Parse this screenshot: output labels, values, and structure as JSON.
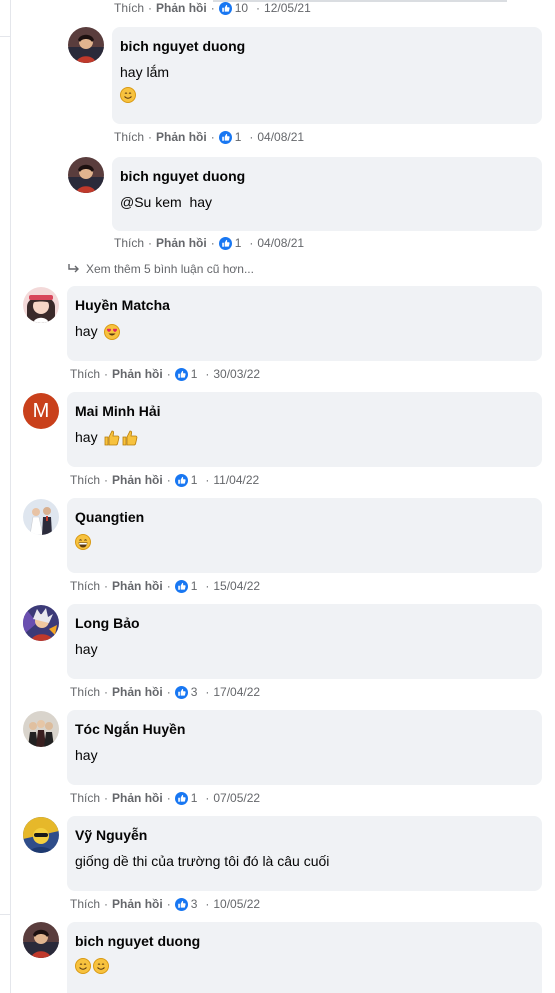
{
  "labels": {
    "like": "Thích",
    "reply": "Phản hồi",
    "dot": "·"
  },
  "top_meta": {
    "count": "10",
    "date": "12/05/21"
  },
  "replies": [
    {
      "author": "bich nguyet duong",
      "text": "hay lắm",
      "emoji": [
        "smile"
      ],
      "likes": "1",
      "date": "04/08/21"
    },
    {
      "author": "bich nguyet duong",
      "text": "@Su kem  hay",
      "emoji": [],
      "likes": "1",
      "date": "04/08/21"
    }
  ],
  "see_more": {
    "label": "Xem thêm 5 bình luận cũ hơn..."
  },
  "comments": [
    {
      "author": "Huyền Matcha",
      "text": "hay",
      "emoji": [
        "heart-eyes"
      ],
      "likes": "1",
      "date": "30/03/22",
      "avatar": "photo-girl"
    },
    {
      "author": "Mai Minh Hải",
      "text": "hay",
      "emoji": [
        "thumbs-up",
        "thumbs-up"
      ],
      "likes": "1",
      "date": "11/04/22",
      "avatar": "letter",
      "avatar_letter": "M",
      "avatar_color": "#c9401b"
    },
    {
      "author": "Quangtien",
      "text": "",
      "emoji": [
        "grin"
      ],
      "likes": "1",
      "date": "15/04/22",
      "avatar": "photo-couple"
    },
    {
      "author": "Long Bảo",
      "text": "hay",
      "emoji": [],
      "likes": "3",
      "date": "17/04/22",
      "avatar": "photo-anime"
    },
    {
      "author": "Tóc Ngắn Huyền",
      "text": "hay",
      "emoji": [],
      "likes": "1",
      "date": "07/05/22",
      "avatar": "photo-group"
    },
    {
      "author": "Vỹ Nguyễn",
      "text": "giống dề thi của trường tôi đó là câu cuối",
      "emoji": [],
      "likes": "3",
      "date": "10/05/22",
      "avatar": "photo-yellow"
    },
    {
      "author": "bich nguyet duong",
      "text": "",
      "emoji": [
        "smile",
        "smile"
      ],
      "likes": "",
      "date": "",
      "avatar": "photo-woman"
    }
  ],
  "colors": {
    "bubble": "#f0f2f5",
    "meta": "#65676b",
    "like_blue": "#1877f2"
  }
}
